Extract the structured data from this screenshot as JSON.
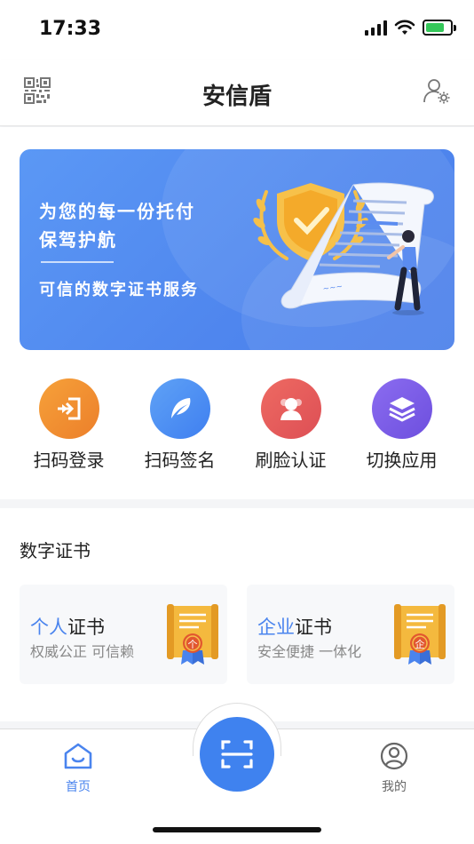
{
  "status_bar": {
    "time": "17:33"
  },
  "nav": {
    "title": "安信盾"
  },
  "banner": {
    "line1": "为您的每一份托付",
    "line2": "保驾护航",
    "subtitle": "可信的数字证书服务"
  },
  "actions": [
    {
      "label": "扫码登录",
      "color": "#f08a2e",
      "icon": "login-icon"
    },
    {
      "label": "扫码签名",
      "color": "#4f8cf2",
      "icon": "feather-icon"
    },
    {
      "label": "刷脸认证",
      "color": "#e4585a",
      "icon": "face-icon"
    },
    {
      "label": "切换应用",
      "color": "#7a5ce6",
      "icon": "layers-icon"
    }
  ],
  "certificates": {
    "section_title": "数字证书",
    "personal": {
      "title_highlight": "个人",
      "title_rest": "证书",
      "desc": "权威公正 可信赖",
      "badge": "个"
    },
    "enterprise": {
      "title_highlight": "企业",
      "title_rest": "证书",
      "desc": "安全便捷 一体化",
      "badge": "企"
    }
  },
  "tabbar": {
    "home": "首页",
    "mine": "我的"
  },
  "colors": {
    "accent": "#4a84ee"
  }
}
